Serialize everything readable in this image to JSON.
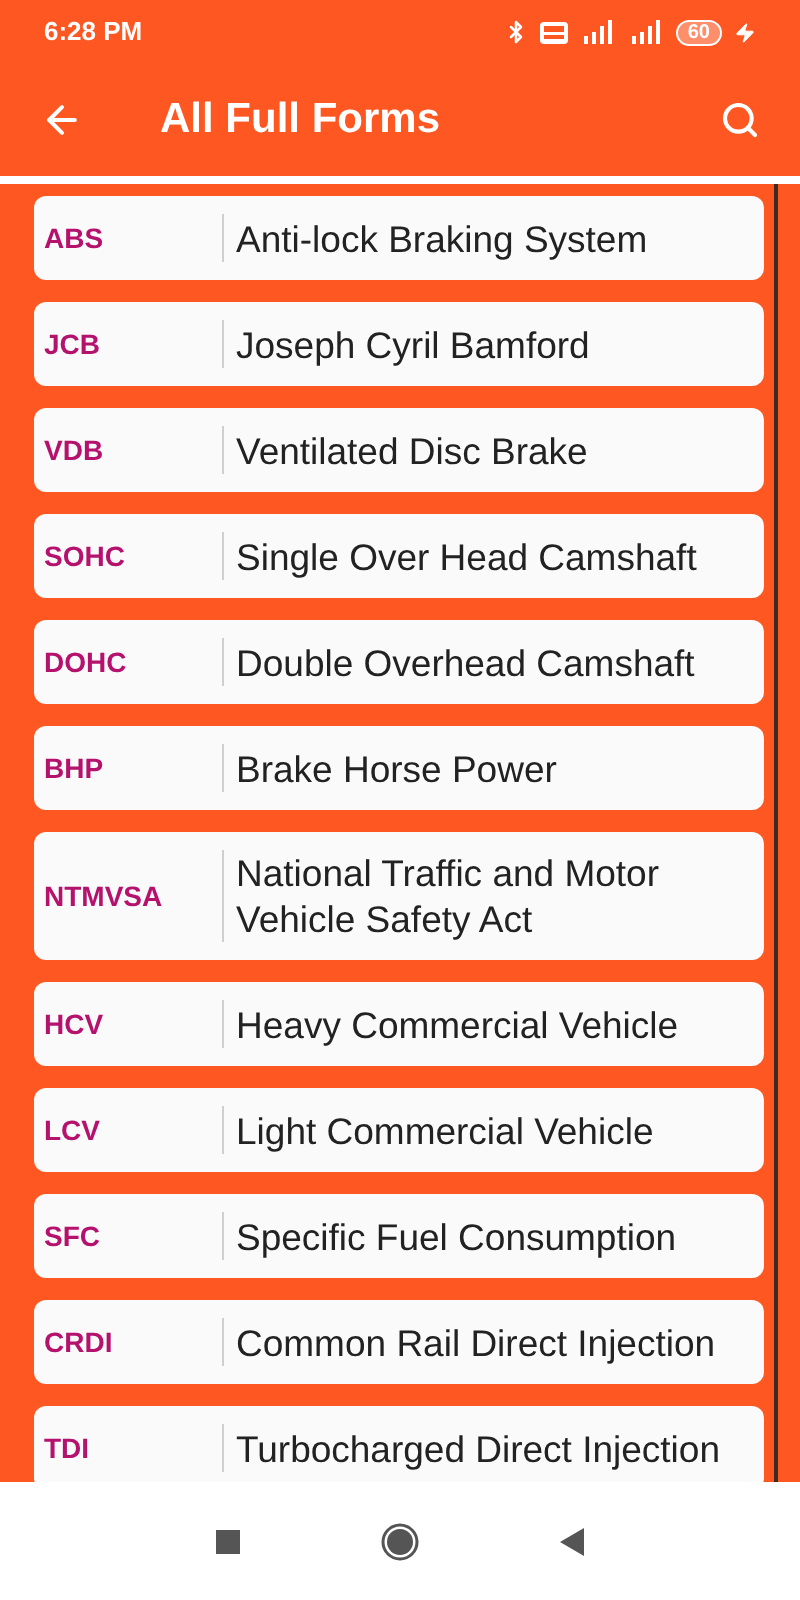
{
  "status_bar": {
    "time": "6:28 PM",
    "battery": "60"
  },
  "app_bar": {
    "title": "All Full Forms"
  },
  "items": [
    {
      "abbr": "ABS",
      "full": "Anti-lock Braking System"
    },
    {
      "abbr": "JCB",
      "full": "Joseph Cyril Bamford"
    },
    {
      "abbr": "VDB",
      "full": "Ventilated Disc Brake"
    },
    {
      "abbr": "SOHC",
      "full": "Single Over Head Camshaft"
    },
    {
      "abbr": "DOHC",
      "full": "Double Overhead Camshaft"
    },
    {
      "abbr": "BHP",
      "full": "Brake Horse Power"
    },
    {
      "abbr": "NTMVSA",
      "full": "National Traffic and Motor Vehicle Safety Act"
    },
    {
      "abbr": "HCV",
      "full": "Heavy Commercial Vehicle"
    },
    {
      "abbr": "LCV",
      "full": "Light Commercial Vehicle"
    },
    {
      "abbr": "SFC",
      "full": "Specific Fuel Consumption"
    },
    {
      "abbr": "CRDI",
      "full": "Common Rail Direct Injection"
    },
    {
      "abbr": "TDI",
      "full": "Turbocharged Direct Injection"
    }
  ]
}
